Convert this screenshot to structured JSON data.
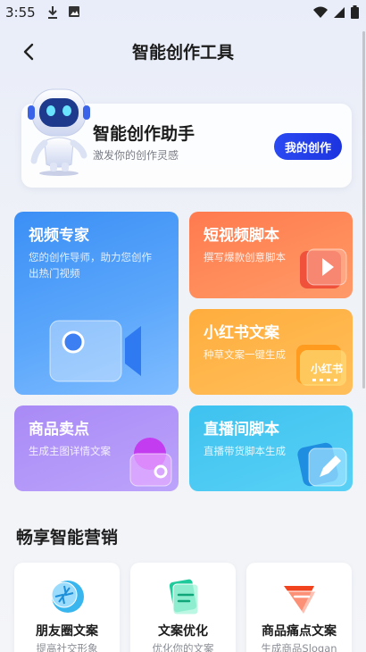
{
  "status_bar": {
    "time": "3:55"
  },
  "header": {
    "title": "智能创作工具"
  },
  "assistant": {
    "title": "智能创作助手",
    "subtitle": "激发你的创作灵感",
    "button": "我的创作"
  },
  "features": {
    "video": {
      "title": "视频专家",
      "subtitle_line1": "您的创作导师，助力您创作",
      "subtitle_line2": "出热门视频"
    },
    "short": {
      "title": "短视频脚本",
      "subtitle": "撰写爆款创意脚本"
    },
    "xhs": {
      "title": "小红书文案",
      "subtitle": "种草文案一键生成",
      "badge": "小红书"
    },
    "goods": {
      "title": "商品卖点",
      "subtitle": "生成主图详情文案"
    },
    "live": {
      "title": "直播间脚本",
      "subtitle": "直播带货脚本生成"
    }
  },
  "marketing": {
    "title": "畅享智能营销",
    "items": [
      {
        "title": "朋友圈文案",
        "subtitle": "提高社交形象"
      },
      {
        "title": "文案优化",
        "subtitle": "优化你的文案"
      },
      {
        "title": "商品痛点文案",
        "subtitle": "生成商品Slogan"
      }
    ]
  },
  "colors": {
    "primary_button": "#2b4af2",
    "video_card": "#3b8ff5",
    "short_card": "#ff7a4f",
    "xhs_card": "#ffad3d",
    "goods_card": "#a98af6",
    "live_card": "#3ec2ef"
  }
}
